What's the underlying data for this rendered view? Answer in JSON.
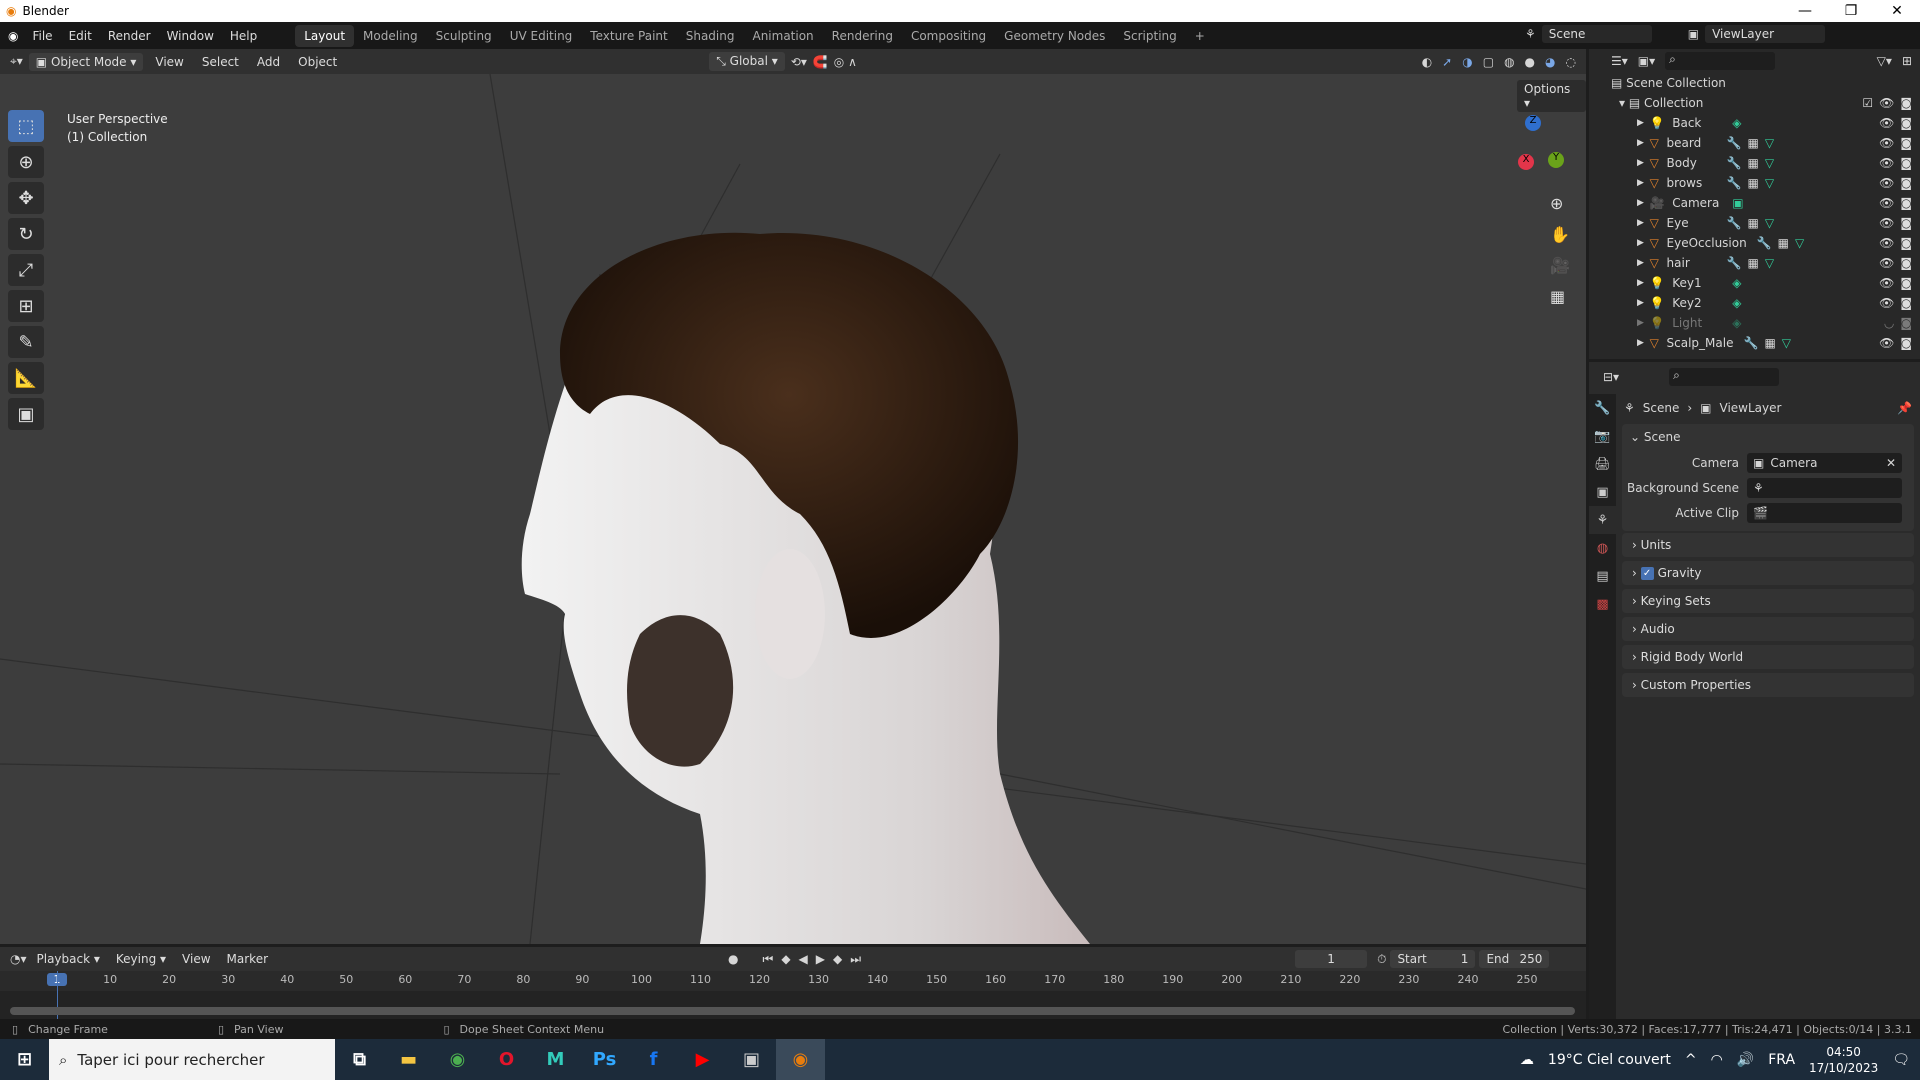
{
  "window": {
    "title": "Blender",
    "minimize": "—",
    "maximize": "❐",
    "close": "✕"
  },
  "menu": [
    "File",
    "Edit",
    "Render",
    "Window",
    "Help"
  ],
  "workspaces": [
    "Layout",
    "Modeling",
    "Sculpting",
    "UV Editing",
    "Texture Paint",
    "Shading",
    "Animation",
    "Rendering",
    "Compositing",
    "Geometry Nodes",
    "Scripting",
    "+"
  ],
  "scene_selector": {
    "scene": "Scene",
    "view_layer": "ViewLayer"
  },
  "viewport_header": {
    "mode": "Object Mode",
    "menus": [
      "View",
      "Select",
      "Add",
      "Object"
    ],
    "orientation": "Global",
    "options": "Options"
  },
  "viewport": {
    "perspective": "User Perspective",
    "collection": "(1) Collection",
    "gizmo": {
      "x": "X",
      "y": "Y",
      "z": "Z"
    }
  },
  "outliner": {
    "root": "Scene Collection",
    "collection": "Collection",
    "items": [
      {
        "name": "Back",
        "type": "light"
      },
      {
        "name": "beard",
        "type": "mesh"
      },
      {
        "name": "Body",
        "type": "mesh"
      },
      {
        "name": "brows",
        "type": "mesh"
      },
      {
        "name": "Camera",
        "type": "camera"
      },
      {
        "name": "Eye",
        "type": "mesh"
      },
      {
        "name": "EyeOcclusion",
        "type": "mesh"
      },
      {
        "name": "hair",
        "type": "mesh"
      },
      {
        "name": "Key1",
        "type": "light"
      },
      {
        "name": "Key2",
        "type": "light"
      },
      {
        "name": "Light",
        "type": "light",
        "hidden": true
      },
      {
        "name": "Scalp_Male",
        "type": "mesh"
      }
    ]
  },
  "properties": {
    "breadcrumb": [
      "Scene",
      "ViewLayer"
    ],
    "section": "Scene",
    "fields": [
      {
        "label": "Camera",
        "value": "Camera"
      },
      {
        "label": "Background Scene",
        "value": ""
      },
      {
        "label": "Active Clip",
        "value": ""
      }
    ],
    "panels": [
      "Units",
      "Gravity",
      "Keying Sets",
      "Audio",
      "Rigid Body World",
      "Custom Properties"
    ],
    "gravity_checked": true
  },
  "timeline": {
    "menus": [
      "Playback",
      "Keying",
      "View",
      "Marker"
    ],
    "current_frame": "1",
    "start_label": "Start",
    "start": "1",
    "end_label": "End",
    "end": "250",
    "ticks": [
      "1",
      "10",
      "20",
      "30",
      "40",
      "50",
      "60",
      "70",
      "80",
      "90",
      "100",
      "110",
      "120",
      "130",
      "140",
      "150",
      "160",
      "170",
      "180",
      "190",
      "200",
      "210",
      "220",
      "230",
      "240",
      "250"
    ]
  },
  "status": {
    "left": [
      "Change Frame",
      "Pan View",
      "Dope Sheet Context Menu"
    ],
    "right": "Collection | Verts:30,372 | Faces:17,777 | Tris:24,471 | Objects:0/14 | 3.3.1"
  },
  "taskbar": {
    "search": "Taper ici pour rechercher",
    "weather": "19°C  Ciel couvert",
    "lang": "FRA",
    "time": "04:50",
    "date": "17/10/2023"
  }
}
